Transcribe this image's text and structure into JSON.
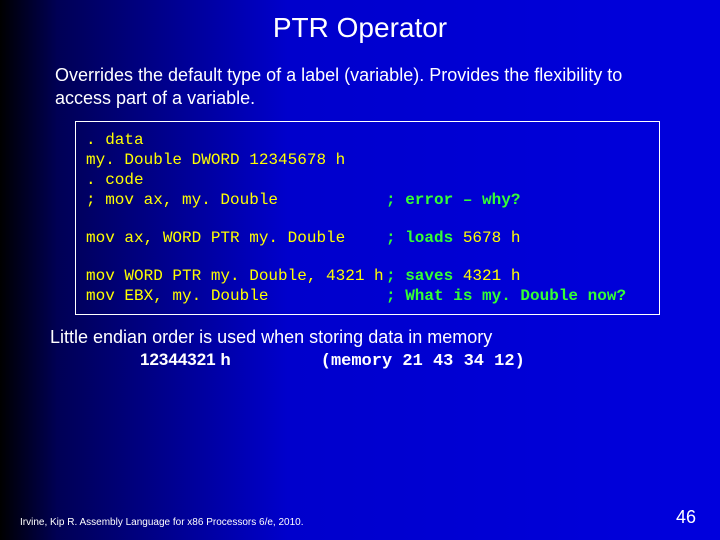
{
  "title": "PTR Operator",
  "intro": "Overrides the default type of a label (variable). Provides the flexibility to access part of a variable.",
  "code": {
    "l1": ". data",
    "l2": "my. Double DWORD 12345678 h",
    "l3": ". code",
    "l4_left": "; mov ax, my. Double",
    "l4_right": "; error – why?",
    "l5_left": "mov ax, WORD PTR my. Double",
    "l5_right_p1": "; loads ",
    "l5_right_p2": "5678 h",
    "l6_left": "mov WORD PTR my. Double, 4321 h",
    "l6_right_p1": "; saves ",
    "l6_right_p2": "4321 h",
    "l7_left": "mov EBX, my. Double",
    "l7_right_p1": "; ",
    "l7_right_p2": "What is my. Double now?"
  },
  "endian_text": "Little endian order is used when storing data in memory",
  "endian_value": "12344321 h",
  "endian_mem": "(memory 21 43 34 12)",
  "footer": "Irvine, Kip R. Assembly Language for x86 Processors 6/e, 2010.",
  "page_number": "46"
}
